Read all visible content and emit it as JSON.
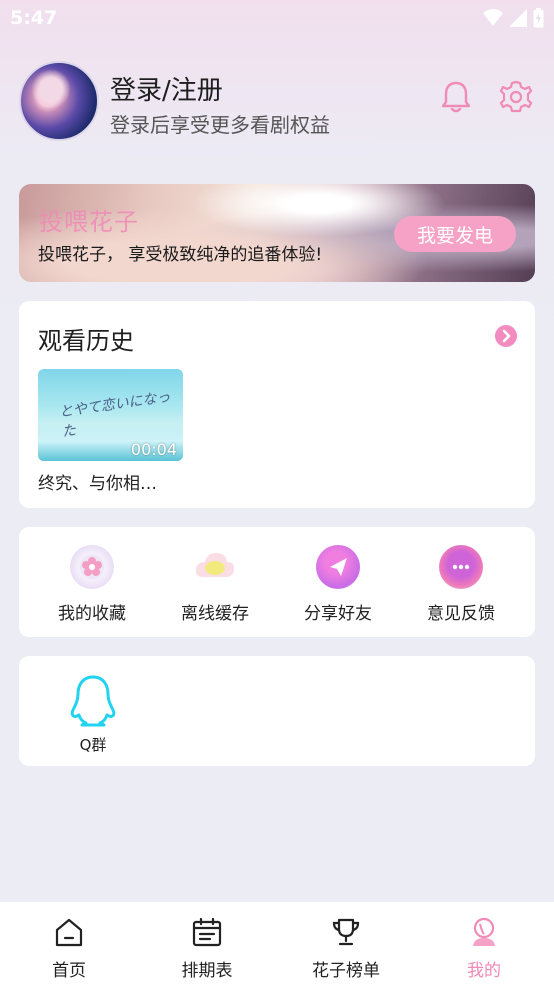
{
  "status_bar": {
    "time": "5:47"
  },
  "profile": {
    "title": "登录/注册",
    "subtitle": "登录后享受更多看剧权益"
  },
  "banner": {
    "big_text": "投喂花子",
    "text": "投喂花子， 享受极致纯净的追番体验!",
    "button": "我要发电"
  },
  "history": {
    "title": "观看历史",
    "items": [
      {
        "title": "终究、与你相…",
        "duration": "00:04",
        "thumb_script": "とやて恋いになった"
      }
    ]
  },
  "menu": {
    "items": [
      {
        "label": "我的收藏",
        "icon": "flower-icon"
      },
      {
        "label": "离线缓存",
        "icon": "cloud-icon"
      },
      {
        "label": "分享好友",
        "icon": "send-icon"
      },
      {
        "label": "意见反馈",
        "icon": "chat-icon"
      }
    ]
  },
  "qq_group": {
    "label": "Q群",
    "icon": "qq-penguin-icon"
  },
  "tabbar": {
    "items": [
      {
        "label": "首页",
        "icon": "home-icon"
      },
      {
        "label": "排期表",
        "icon": "calendar-icon"
      },
      {
        "label": "花子榜单",
        "icon": "trophy-icon"
      },
      {
        "label": "我的",
        "icon": "profile-icon"
      }
    ],
    "active_index": 3
  },
  "colors": {
    "accent": "#f08ab7",
    "banner_button": "#f5a2c6",
    "qq_icon": "#22d3f0"
  }
}
